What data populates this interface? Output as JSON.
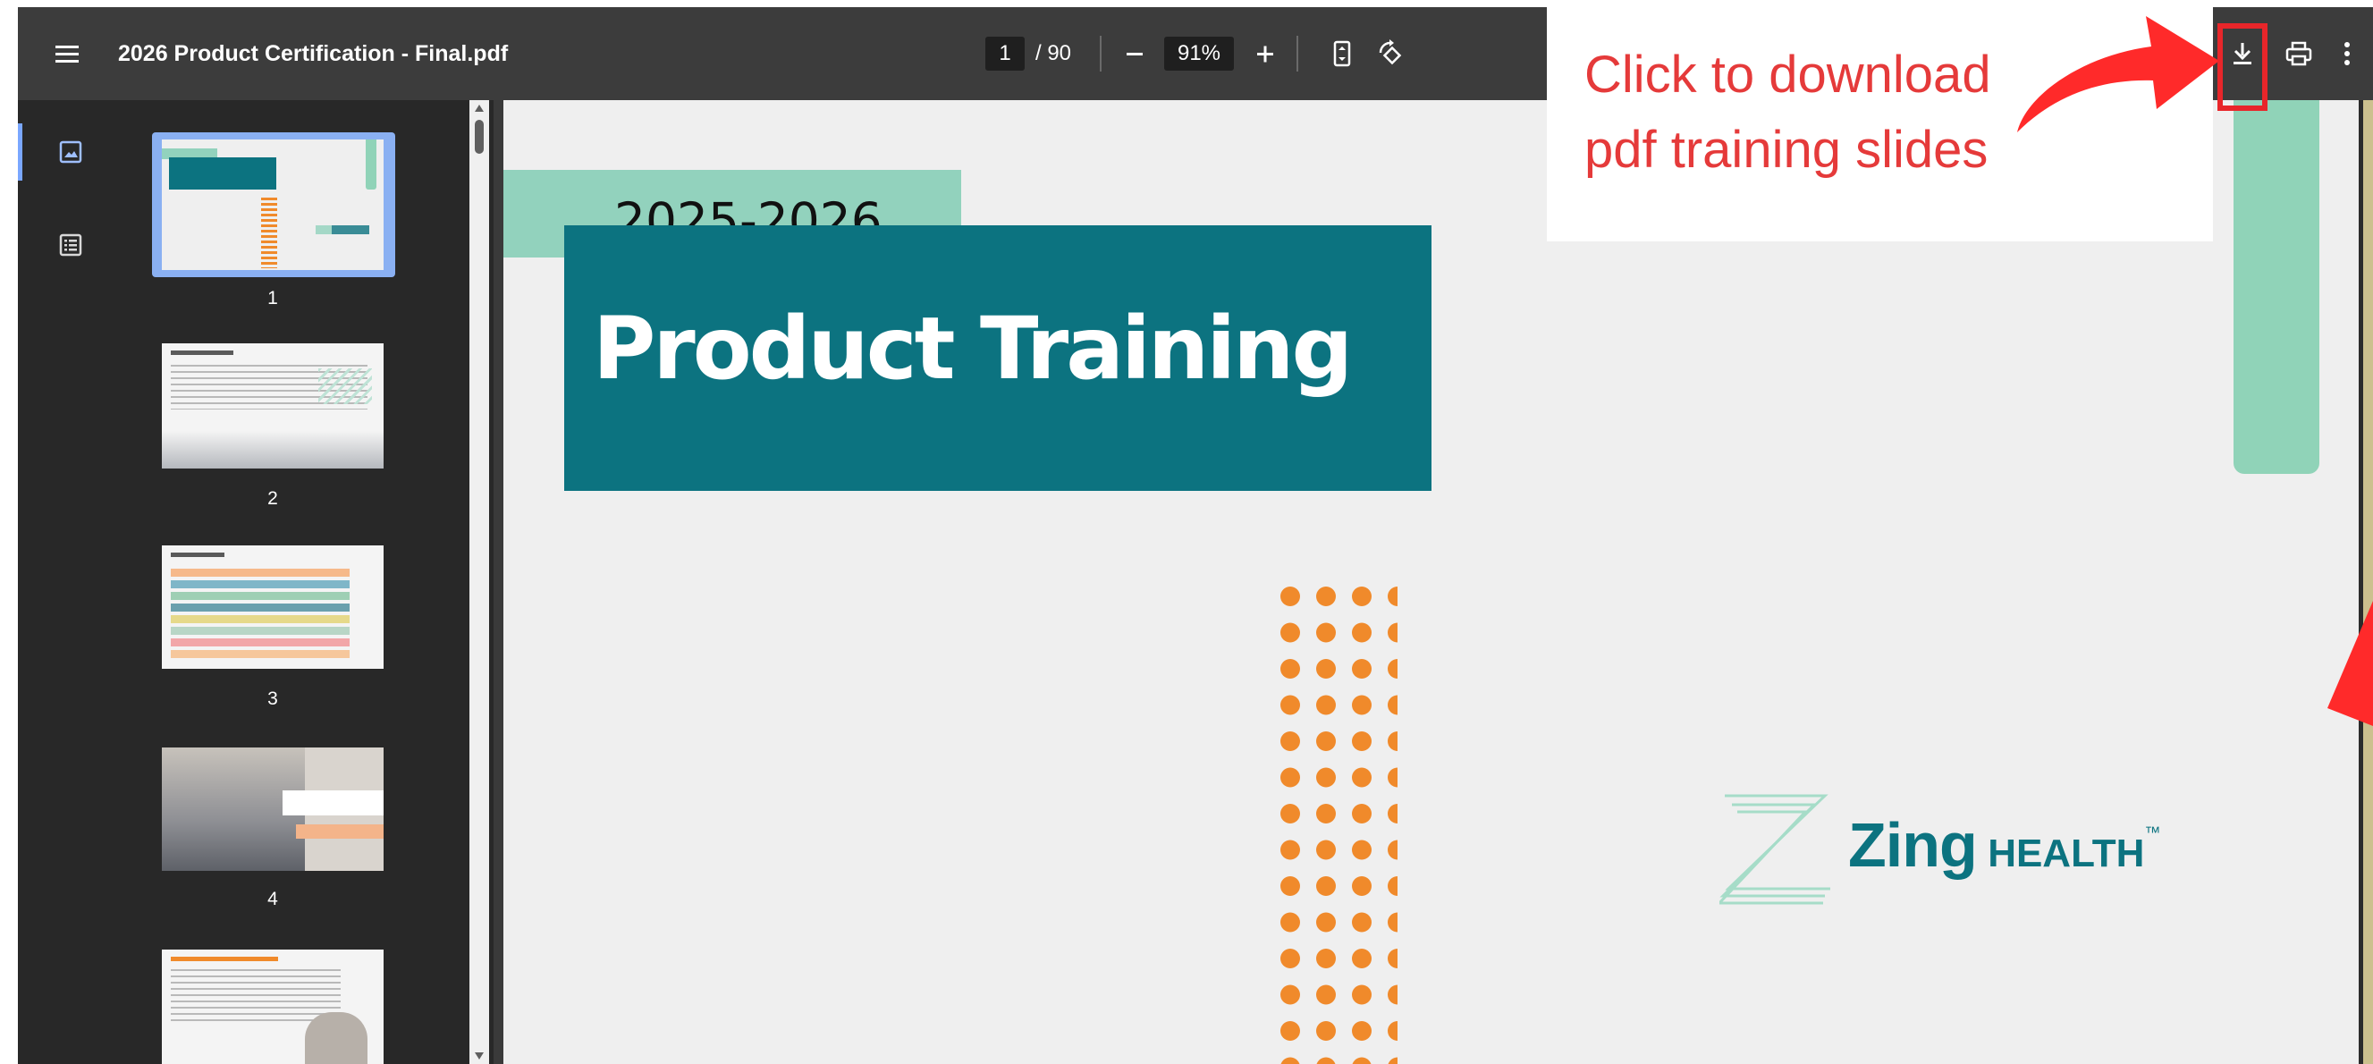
{
  "toolbar": {
    "title": "2026 Product Certification - Final.pdf",
    "page_current": "1",
    "page_total": "/ 90",
    "zoom": "91%",
    "icons": {
      "menu": "menu-icon",
      "zoom_out": "minus-icon",
      "zoom_in": "plus-icon",
      "fit_page": "fit-page-icon",
      "rotate": "rotate-icon",
      "download": "download-icon",
      "print": "print-icon",
      "more": "more-vert-icon"
    }
  },
  "sidebar": {
    "tabs": [
      {
        "name": "thumbnails",
        "icon": "image-icon",
        "active": true
      },
      {
        "name": "outline",
        "icon": "list-icon",
        "active": false
      }
    ],
    "thumbnails": [
      {
        "page": "1",
        "selected": true
      },
      {
        "page": "2",
        "selected": false
      },
      {
        "page": "3",
        "selected": false
      },
      {
        "page": "4",
        "selected": false
      },
      {
        "page": "5",
        "selected": false
      }
    ]
  },
  "slide": {
    "year": "2025-2026",
    "title": "Product Training",
    "logo": {
      "brand": "Zing",
      "suffix": "HEALTH",
      "tm": "™"
    },
    "colors": {
      "teal": "#0c7380",
      "mint": "#92d2bd",
      "orange": "#f08a2b",
      "background": "#efefef"
    }
  },
  "annotation": {
    "text": "Click to download pdf training slides",
    "color": "#e53a3a",
    "target": "download-button"
  }
}
